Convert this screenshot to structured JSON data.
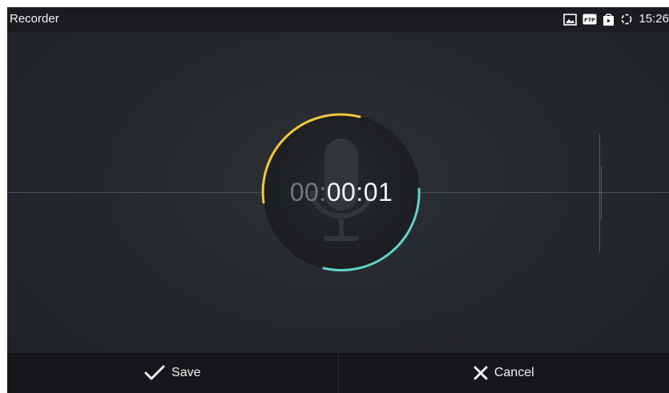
{
  "statusbar": {
    "app_title": "Recorder",
    "clock": "15:26",
    "icons": [
      "image-icon",
      "ftp-icon",
      "store-icon",
      "sync-icon"
    ]
  },
  "recorder": {
    "timer_hours": "00:",
    "timer_elapsed": "00:01",
    "colors": {
      "arc_start": "#f3c83a",
      "arc_end": "#5fd3c7"
    }
  },
  "actions": {
    "save_label": "Save",
    "cancel_label": "Cancel"
  }
}
